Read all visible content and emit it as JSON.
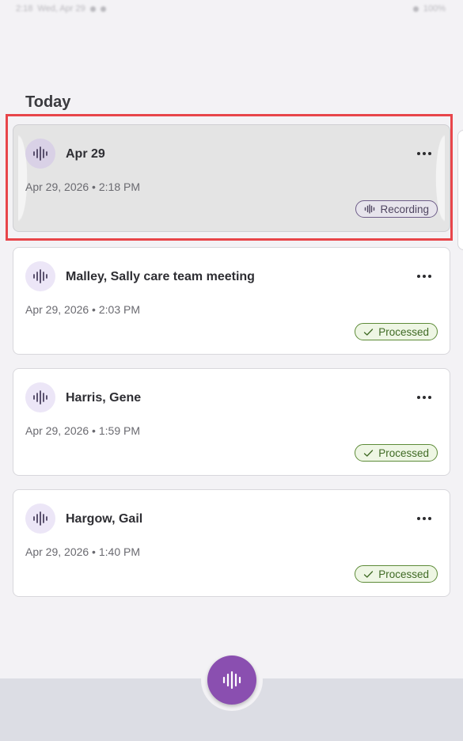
{
  "status_bar": {
    "time": "2:18",
    "date": "Wed, Apr 29",
    "battery": "100%"
  },
  "section": {
    "title": "Today"
  },
  "recordings": [
    {
      "title": "Apr 29",
      "date": "Apr 29, 2026 • 2:18 PM",
      "status": "Recording",
      "status_type": "recording",
      "icon": "waveform-icon",
      "highlighted": true
    },
    {
      "title": "Malley, Sally care team meeting",
      "date": "Apr 29, 2026 • 2:03 PM",
      "status": "Processed",
      "status_type": "processed",
      "icon": "waveform-icon"
    },
    {
      "title": "Harris, Gene",
      "date": "Apr 29, 2026 • 1:59 PM",
      "status": "Processed",
      "status_type": "processed",
      "icon": "waveform-icon"
    },
    {
      "title": "Hargow, Gail",
      "date": "Apr 29, 2026 • 1:40 PM",
      "status": "Processed",
      "status_type": "processed",
      "icon": "waveform-icon"
    }
  ],
  "fab": {
    "icon": "waveform-icon"
  },
  "colors": {
    "accent": "#8a4fb0",
    "processed": "#5d8b38",
    "recording": "#6e5d88",
    "highlight": "#e8454a"
  }
}
